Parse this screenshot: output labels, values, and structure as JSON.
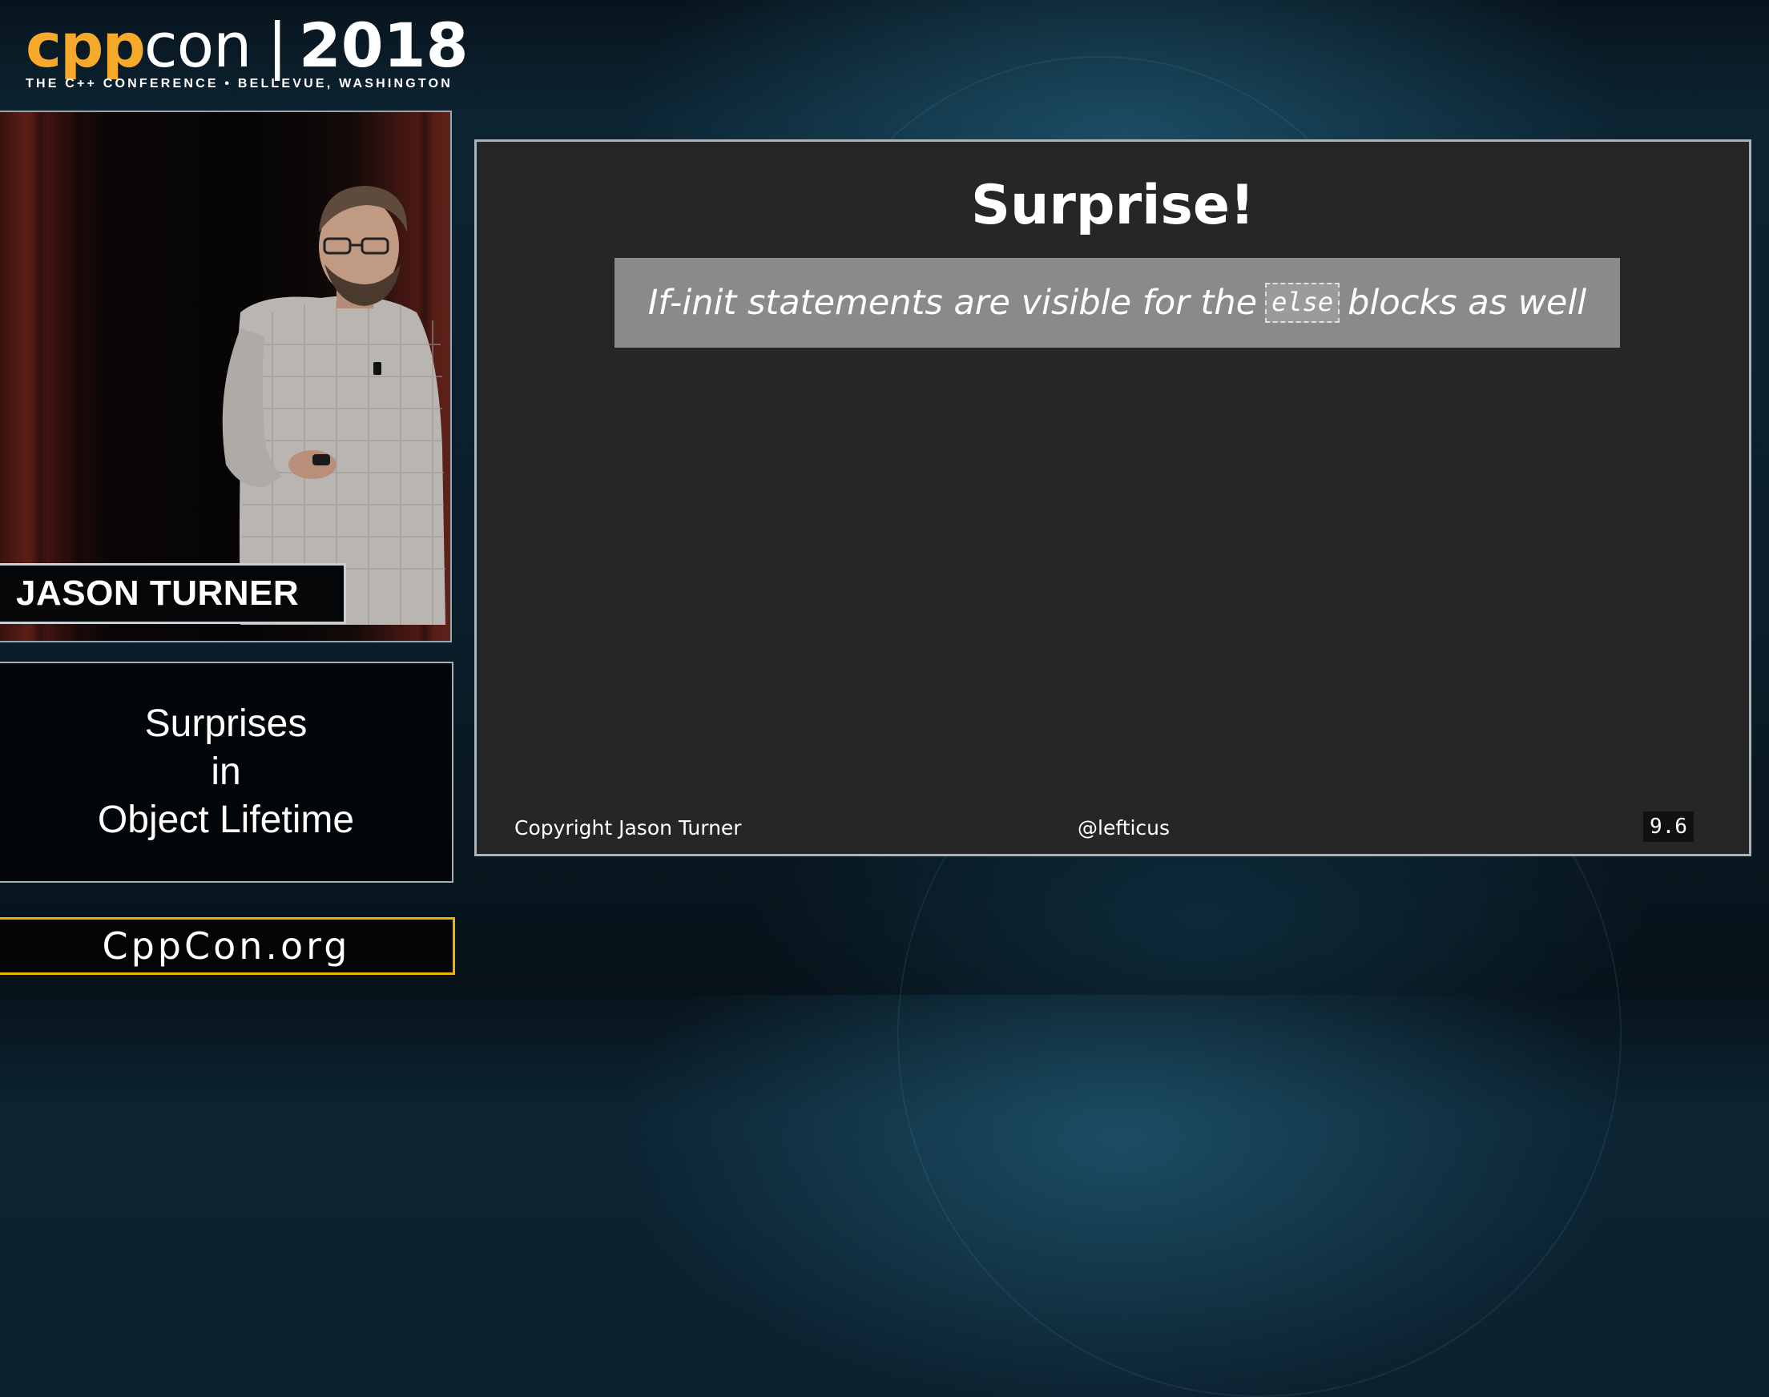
{
  "logo": {
    "cpp": "cpp",
    "con": "con",
    "separator": "|",
    "year": "2018",
    "tagline": "THE C++ CONFERENCE • BELLEVUE, WASHINGTON"
  },
  "speaker": {
    "name": "JASON TURNER"
  },
  "talk": {
    "title_lines": [
      "Surprises",
      "in",
      "Object Lifetime"
    ]
  },
  "site": {
    "label": "CppCon.org"
  },
  "slide": {
    "title": "Surprise!",
    "quote": {
      "before": "If-init statements are visible for the",
      "code": "else",
      "after": "blocks as well"
    },
    "footer": {
      "copyright": "Copyright Jason Turner",
      "handle": "@lefticus",
      "page": "9.6"
    }
  },
  "colors": {
    "brand_orange": "#f7a929",
    "site_border": "#f0b000",
    "slide_background": "#262626",
    "quote_background": "#8a8a8a"
  }
}
